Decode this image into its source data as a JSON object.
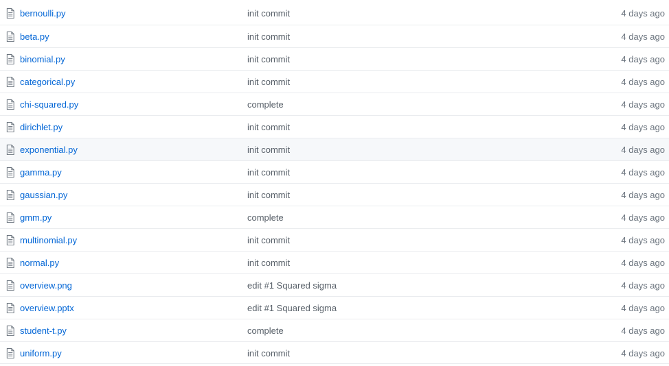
{
  "colors": {
    "link": "#0366d6",
    "message": "#586069",
    "age": "#6a737d",
    "row_border": "#eaecef",
    "row_highlight": "#f6f8fa"
  },
  "files": [
    {
      "name": "bernoulli.py",
      "icon": "file-icon",
      "message": "init commit",
      "age": "4 days ago"
    },
    {
      "name": "beta.py",
      "icon": "file-icon",
      "message": "init commit",
      "age": "4 days ago"
    },
    {
      "name": "binomial.py",
      "icon": "file-icon",
      "message": "init commit",
      "age": "4 days ago"
    },
    {
      "name": "categorical.py",
      "icon": "file-icon",
      "message": "init commit",
      "age": "4 days ago"
    },
    {
      "name": "chi-squared.py",
      "icon": "file-icon",
      "message": "complete",
      "age": "4 days ago"
    },
    {
      "name": "dirichlet.py",
      "icon": "file-icon",
      "message": "init commit",
      "age": "4 days ago"
    },
    {
      "name": "exponential.py",
      "icon": "file-icon",
      "message": "init commit",
      "age": "4 days ago",
      "highlighted": true
    },
    {
      "name": "gamma.py",
      "icon": "file-icon",
      "message": "init commit",
      "age": "4 days ago"
    },
    {
      "name": "gaussian.py",
      "icon": "file-icon",
      "message": "init commit",
      "age": "4 days ago"
    },
    {
      "name": "gmm.py",
      "icon": "file-icon",
      "message": "complete",
      "age": "4 days ago"
    },
    {
      "name": "multinomial.py",
      "icon": "file-icon",
      "message": "init commit",
      "age": "4 days ago"
    },
    {
      "name": "normal.py",
      "icon": "file-icon",
      "message": "init commit",
      "age": "4 days ago"
    },
    {
      "name": "overview.png",
      "icon": "file-icon",
      "message": "edit #1 Squared sigma",
      "age": "4 days ago"
    },
    {
      "name": "overview.pptx",
      "icon": "file-icon",
      "message": "edit #1 Squared sigma",
      "age": "4 days ago"
    },
    {
      "name": "student-t.py",
      "icon": "file-icon",
      "message": "complete",
      "age": "4 days ago"
    },
    {
      "name": "uniform.py",
      "icon": "file-icon",
      "message": "init commit",
      "age": "4 days ago"
    }
  ]
}
